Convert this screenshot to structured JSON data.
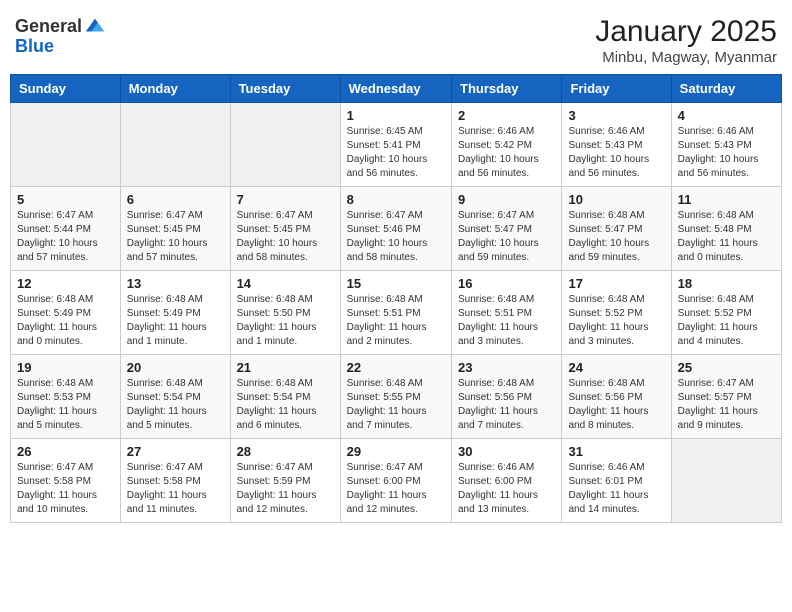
{
  "header": {
    "logo_general": "General",
    "logo_blue": "Blue",
    "month": "January 2025",
    "location": "Minbu, Magway, Myanmar"
  },
  "weekdays": [
    "Sunday",
    "Monday",
    "Tuesday",
    "Wednesday",
    "Thursday",
    "Friday",
    "Saturday"
  ],
  "weeks": [
    [
      {
        "day": "",
        "info": ""
      },
      {
        "day": "",
        "info": ""
      },
      {
        "day": "",
        "info": ""
      },
      {
        "day": "1",
        "info": "Sunrise: 6:45 AM\nSunset: 5:41 PM\nDaylight: 10 hours and 56 minutes."
      },
      {
        "day": "2",
        "info": "Sunrise: 6:46 AM\nSunset: 5:42 PM\nDaylight: 10 hours and 56 minutes."
      },
      {
        "day": "3",
        "info": "Sunrise: 6:46 AM\nSunset: 5:43 PM\nDaylight: 10 hours and 56 minutes."
      },
      {
        "day": "4",
        "info": "Sunrise: 6:46 AM\nSunset: 5:43 PM\nDaylight: 10 hours and 56 minutes."
      }
    ],
    [
      {
        "day": "5",
        "info": "Sunrise: 6:47 AM\nSunset: 5:44 PM\nDaylight: 10 hours and 57 minutes."
      },
      {
        "day": "6",
        "info": "Sunrise: 6:47 AM\nSunset: 5:45 PM\nDaylight: 10 hours and 57 minutes."
      },
      {
        "day": "7",
        "info": "Sunrise: 6:47 AM\nSunset: 5:45 PM\nDaylight: 10 hours and 58 minutes."
      },
      {
        "day": "8",
        "info": "Sunrise: 6:47 AM\nSunset: 5:46 PM\nDaylight: 10 hours and 58 minutes."
      },
      {
        "day": "9",
        "info": "Sunrise: 6:47 AM\nSunset: 5:47 PM\nDaylight: 10 hours and 59 minutes."
      },
      {
        "day": "10",
        "info": "Sunrise: 6:48 AM\nSunset: 5:47 PM\nDaylight: 10 hours and 59 minutes."
      },
      {
        "day": "11",
        "info": "Sunrise: 6:48 AM\nSunset: 5:48 PM\nDaylight: 11 hours and 0 minutes."
      }
    ],
    [
      {
        "day": "12",
        "info": "Sunrise: 6:48 AM\nSunset: 5:49 PM\nDaylight: 11 hours and 0 minutes."
      },
      {
        "day": "13",
        "info": "Sunrise: 6:48 AM\nSunset: 5:49 PM\nDaylight: 11 hours and 1 minute."
      },
      {
        "day": "14",
        "info": "Sunrise: 6:48 AM\nSunset: 5:50 PM\nDaylight: 11 hours and 1 minute."
      },
      {
        "day": "15",
        "info": "Sunrise: 6:48 AM\nSunset: 5:51 PM\nDaylight: 11 hours and 2 minutes."
      },
      {
        "day": "16",
        "info": "Sunrise: 6:48 AM\nSunset: 5:51 PM\nDaylight: 11 hours and 3 minutes."
      },
      {
        "day": "17",
        "info": "Sunrise: 6:48 AM\nSunset: 5:52 PM\nDaylight: 11 hours and 3 minutes."
      },
      {
        "day": "18",
        "info": "Sunrise: 6:48 AM\nSunset: 5:52 PM\nDaylight: 11 hours and 4 minutes."
      }
    ],
    [
      {
        "day": "19",
        "info": "Sunrise: 6:48 AM\nSunset: 5:53 PM\nDaylight: 11 hours and 5 minutes."
      },
      {
        "day": "20",
        "info": "Sunrise: 6:48 AM\nSunset: 5:54 PM\nDaylight: 11 hours and 5 minutes."
      },
      {
        "day": "21",
        "info": "Sunrise: 6:48 AM\nSunset: 5:54 PM\nDaylight: 11 hours and 6 minutes."
      },
      {
        "day": "22",
        "info": "Sunrise: 6:48 AM\nSunset: 5:55 PM\nDaylight: 11 hours and 7 minutes."
      },
      {
        "day": "23",
        "info": "Sunrise: 6:48 AM\nSunset: 5:56 PM\nDaylight: 11 hours and 7 minutes."
      },
      {
        "day": "24",
        "info": "Sunrise: 6:48 AM\nSunset: 5:56 PM\nDaylight: 11 hours and 8 minutes."
      },
      {
        "day": "25",
        "info": "Sunrise: 6:47 AM\nSunset: 5:57 PM\nDaylight: 11 hours and 9 minutes."
      }
    ],
    [
      {
        "day": "26",
        "info": "Sunrise: 6:47 AM\nSunset: 5:58 PM\nDaylight: 11 hours and 10 minutes."
      },
      {
        "day": "27",
        "info": "Sunrise: 6:47 AM\nSunset: 5:58 PM\nDaylight: 11 hours and 11 minutes."
      },
      {
        "day": "28",
        "info": "Sunrise: 6:47 AM\nSunset: 5:59 PM\nDaylight: 11 hours and 12 minutes."
      },
      {
        "day": "29",
        "info": "Sunrise: 6:47 AM\nSunset: 6:00 PM\nDaylight: 11 hours and 12 minutes."
      },
      {
        "day": "30",
        "info": "Sunrise: 6:46 AM\nSunset: 6:00 PM\nDaylight: 11 hours and 13 minutes."
      },
      {
        "day": "31",
        "info": "Sunrise: 6:46 AM\nSunset: 6:01 PM\nDaylight: 11 hours and 14 minutes."
      },
      {
        "day": "",
        "info": ""
      }
    ]
  ]
}
